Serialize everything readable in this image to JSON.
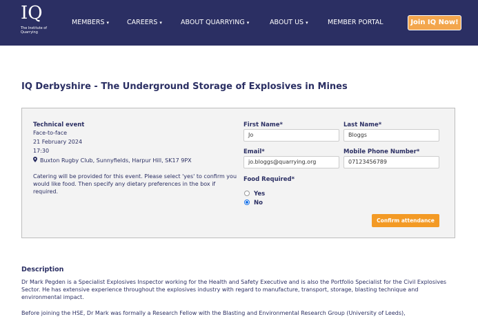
{
  "header": {
    "logo_mark": "IQ",
    "logo_subtitle": "The Institute of Quarrying",
    "nav": [
      {
        "label": "MEMBERS",
        "caret": "▾"
      },
      {
        "label": "CAREERS",
        "caret": "▾"
      },
      {
        "label": "ABOUT QUARRYING",
        "caret": "▾"
      },
      {
        "label": "ABOUT US",
        "caret": "▾"
      },
      {
        "label": "MEMBER PORTAL",
        "caret": ""
      }
    ],
    "join_label": "Join IQ Now!"
  },
  "page_title": "IQ Derbyshire - The Underground Storage of Explosives in Mines",
  "event": {
    "type": "Technical event",
    "format": "Face-to-face",
    "date": "21 February 2024",
    "time": "17:30",
    "location": "Buxton Rugby Club, Sunnyfields, Harpur Hill, SK17 9PX",
    "note": "Catering will be provided for this event. Please select 'yes' to confirm you would like food. Then specify any dietary preferences in the box if required."
  },
  "form": {
    "first_name_label": "First Name*",
    "first_name_value": "Jo",
    "last_name_label": "Last Name*",
    "last_name_value": "Bloggs",
    "email_label": "Email*",
    "email_value": "jo.bloggs@quarrying.org",
    "phone_label": "Mobile Phone Number*",
    "phone_value": "07123456789",
    "food_label": "Food Required*",
    "food_options": [
      {
        "label": "Yes",
        "selected": false
      },
      {
        "label": "No",
        "selected": true
      }
    ],
    "confirm_label": "Confirm attendance"
  },
  "description": {
    "heading": "Description",
    "paragraphs": [
      "Dr Mark Pegden is a Specialist Explosives Inspector working for the Health and Safety Executive and is also the Portfolio Specialist for the Civil Explosives Sector. He has extensive experience throughout the explosives industry with regard to manufacture, transport, storage, blasting technique and environmental impact.",
      "Before joining the HSE, Dr Mark was formally a Research Fellow with the Blasting and Environmental Research Group (University of Leeds),"
    ]
  },
  "colors": {
    "header_bg": "#2b2f63",
    "join_button": "#f3a64d",
    "confirm_button": "#f39a25",
    "text_navy": "#2b2f63"
  }
}
